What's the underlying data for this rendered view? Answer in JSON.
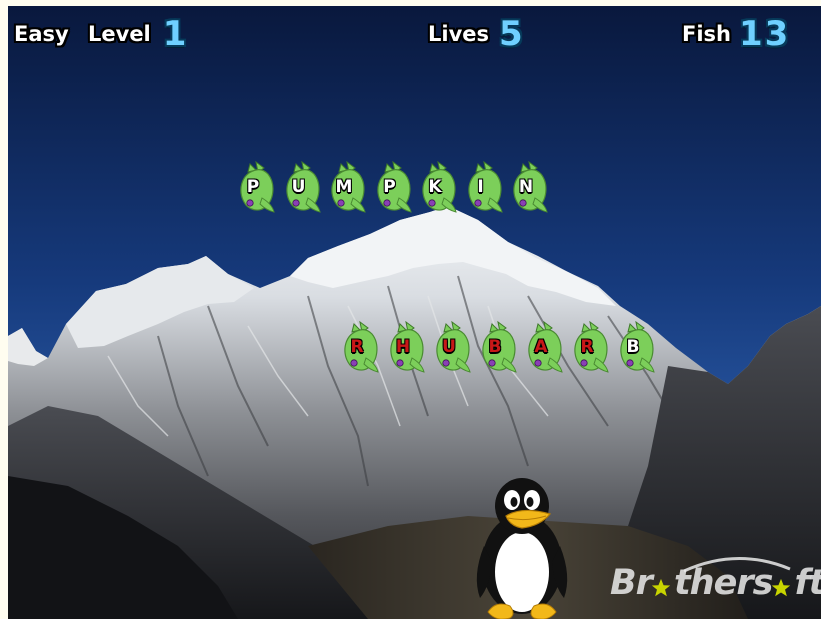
{
  "hud": {
    "difficulty": "Easy",
    "level_label": "Level",
    "level_value": "1",
    "lives_label": "Lives",
    "lives_value": "5",
    "fish_label": "Fish",
    "fish_value": "13"
  },
  "words": [
    {
      "letters": [
        "P",
        "U",
        "M",
        "P",
        "K",
        "I",
        "N"
      ],
      "typed_count": 0
    },
    {
      "letters": [
        "R",
        "H",
        "U",
        "B",
        "A",
        "R",
        "B"
      ],
      "typed_count": 6
    }
  ],
  "watermark": {
    "text_before": "Br",
    "text_middle": "thers",
    "text_after": "ft"
  },
  "colors": {
    "sky_top": "#0b1f4e",
    "sky_bottom": "#2a58a8",
    "fish_green": "#7ccf5a",
    "typed_letter": "#c81818",
    "hud_number": "#6fd0ff"
  },
  "icons": {
    "fish": "fish-icon",
    "player": "penguin-icon",
    "watermark_star": "star-icon"
  }
}
